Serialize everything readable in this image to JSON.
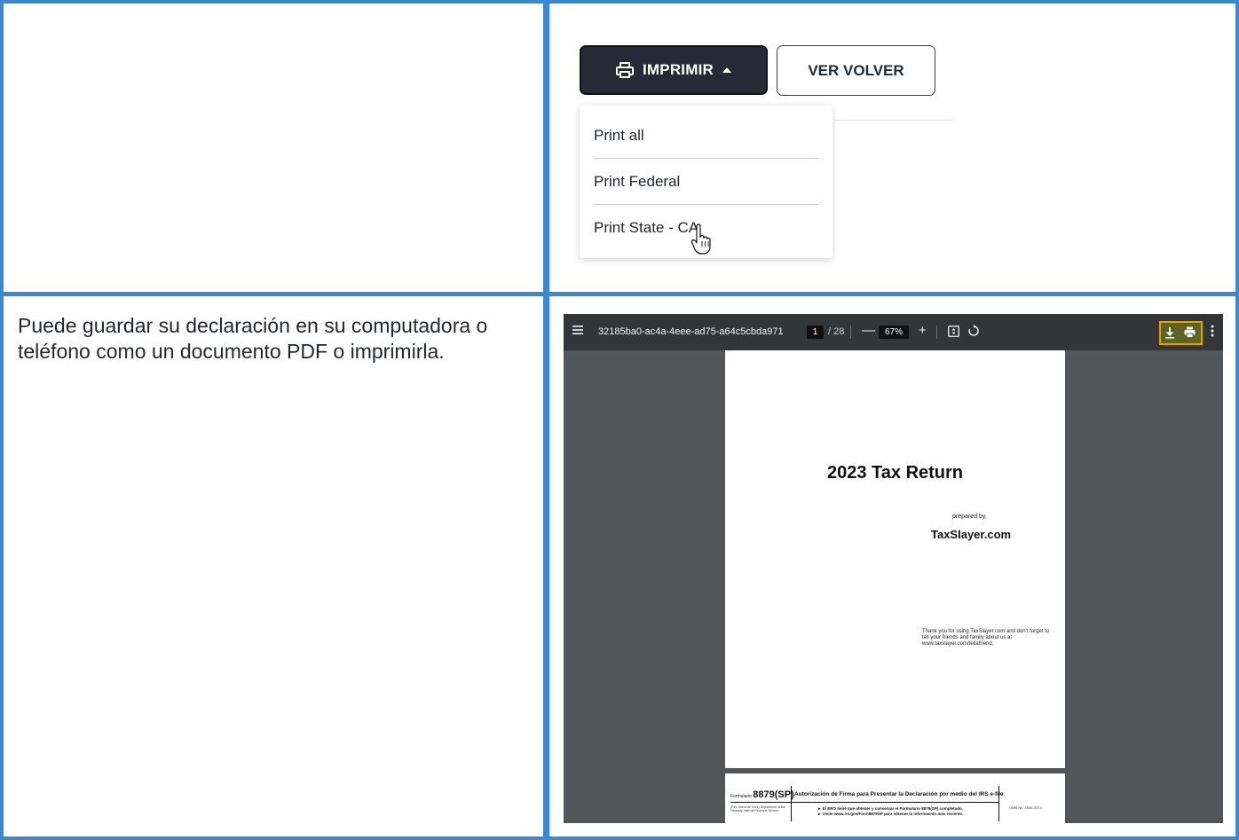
{
  "print_button": {
    "label": "IMPRIMIR",
    "icon": "printer-icon",
    "caret": "caret-up-icon"
  },
  "back_button": {
    "label": "VER VOLVER"
  },
  "print_menu": {
    "items": [
      "Print all",
      "Print Federal",
      "Print State - CA"
    ]
  },
  "description": "Puede guardar su declaración en su computadora o teléfono como un documento PDF o imprimirla.",
  "pdf_viewer": {
    "file_name": "32185ba0-ac4a-4eee-ad75-a64c5cbda971",
    "current_page": "1",
    "total_pages": "/ 28",
    "zoom": "67%",
    "minus": "—",
    "plus": "+",
    "highlight_color": "#e8a100"
  },
  "page1": {
    "title": "2023 Tax Return",
    "prepared_by": "prepared by,",
    "brand": "TaxSlayer.com",
    "thanks": "Thank you for using TaxSlayer.com and don't forget to tell your friends and family about us at www.taxslayer.com/tellafriend."
  },
  "page2": {
    "form_prefix": "Formulario",
    "form_number": "8879(SP)",
    "heading": "Autorización de Firma para Presentar la Declaración por medio del IRS e-file",
    "rev": "(Rev. enero de 2021) Department of the Treasury Internal Revenue Service",
    "note1": "► El ERO tiene que obtener y conservar el Formulario 8879(SP) completado.",
    "note2": "► Visite www.irs.gov/Form8879SP para obtener la información más reciente.",
    "omb": "OMB No. 1545-0074"
  }
}
